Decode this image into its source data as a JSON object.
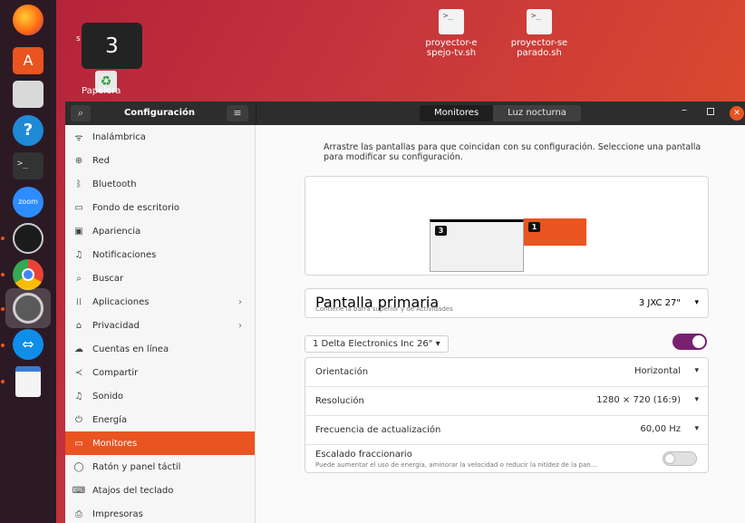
{
  "osd": {
    "number": "3"
  },
  "desktop": {
    "trash_label": "Papelera",
    "s_fragment": "s",
    "files": [
      {
        "name": "proyector-espejo-tv.sh"
      },
      {
        "name": "proyector-separado.sh"
      }
    ]
  },
  "dock": {
    "items": [
      "firefox-icon",
      "software-icon",
      "files-icon",
      "help-icon",
      "terminal-icon",
      "zoom-icon",
      "obs-icon",
      "chrome-icon",
      "settings-icon",
      "teamviewer-icon",
      "text-editor-icon"
    ],
    "zoom_text": "zoom"
  },
  "titlebar": {
    "app_title": "Configuración",
    "tabs": [
      "Monitores",
      "Luz nocturna"
    ],
    "active_tab": "Monitores"
  },
  "sidebar": {
    "items": [
      {
        "label": "Inalámbrica",
        "icon": "wifi-icon"
      },
      {
        "label": "Red",
        "icon": "network-icon"
      },
      {
        "label": "Bluetooth",
        "icon": "bluetooth-icon"
      },
      {
        "label": "Fondo de escritorio",
        "icon": "background-icon"
      },
      {
        "label": "Apariencia",
        "icon": "appearance-icon"
      },
      {
        "label": "Notificaciones",
        "icon": "bell-icon"
      },
      {
        "label": "Buscar",
        "icon": "search-icon"
      },
      {
        "label": "Aplicaciones",
        "icon": "apps-icon"
      },
      {
        "label": "Privacidad",
        "icon": "privacy-icon"
      },
      {
        "label": "Cuentas en línea",
        "icon": "cloud-icon"
      },
      {
        "label": "Compartir",
        "icon": "share-icon"
      },
      {
        "label": "Sonido",
        "icon": "music-icon"
      },
      {
        "label": "Energía",
        "icon": "power-icon"
      },
      {
        "label": "Monitores",
        "icon": "display-icon"
      },
      {
        "label": "Ratón y panel táctil",
        "icon": "mouse-icon"
      },
      {
        "label": "Atajos del teclado",
        "icon": "keyboard-icon"
      },
      {
        "label": "Impresoras",
        "icon": "printer-icon"
      }
    ],
    "active_index": 13
  },
  "main": {
    "hint": "Arrastre las pantallas para que coincidan con su configuración. Seleccione una pantalla para modificar su configuración.",
    "arrangement": {
      "monitor_a": "3",
      "monitor_b": "1"
    },
    "primary": {
      "label": "Pantalla primaria",
      "sub": "Contiene la barra superior y de Actividades",
      "value": "3  JXC 27\""
    },
    "monitor_select": "1  Delta Electronics Inc 26\"",
    "monitor_enabled": true,
    "settings": [
      {
        "label": "Orientación",
        "value": "Horizontal"
      },
      {
        "label": "Resolución",
        "value": "1280 × 720 (16:9)"
      },
      {
        "label": "Frecuencia de actualización",
        "value": "60,00 Hz"
      }
    ],
    "fractional": {
      "label": "Escalado fraccionario",
      "sub": "Puede aumentar el uso de energía, aminorar la velocidad o reducir la nitidez de la pan…",
      "enabled": false
    }
  },
  "colors": {
    "accent": "#e95420",
    "toggle_on": "#77216f"
  }
}
